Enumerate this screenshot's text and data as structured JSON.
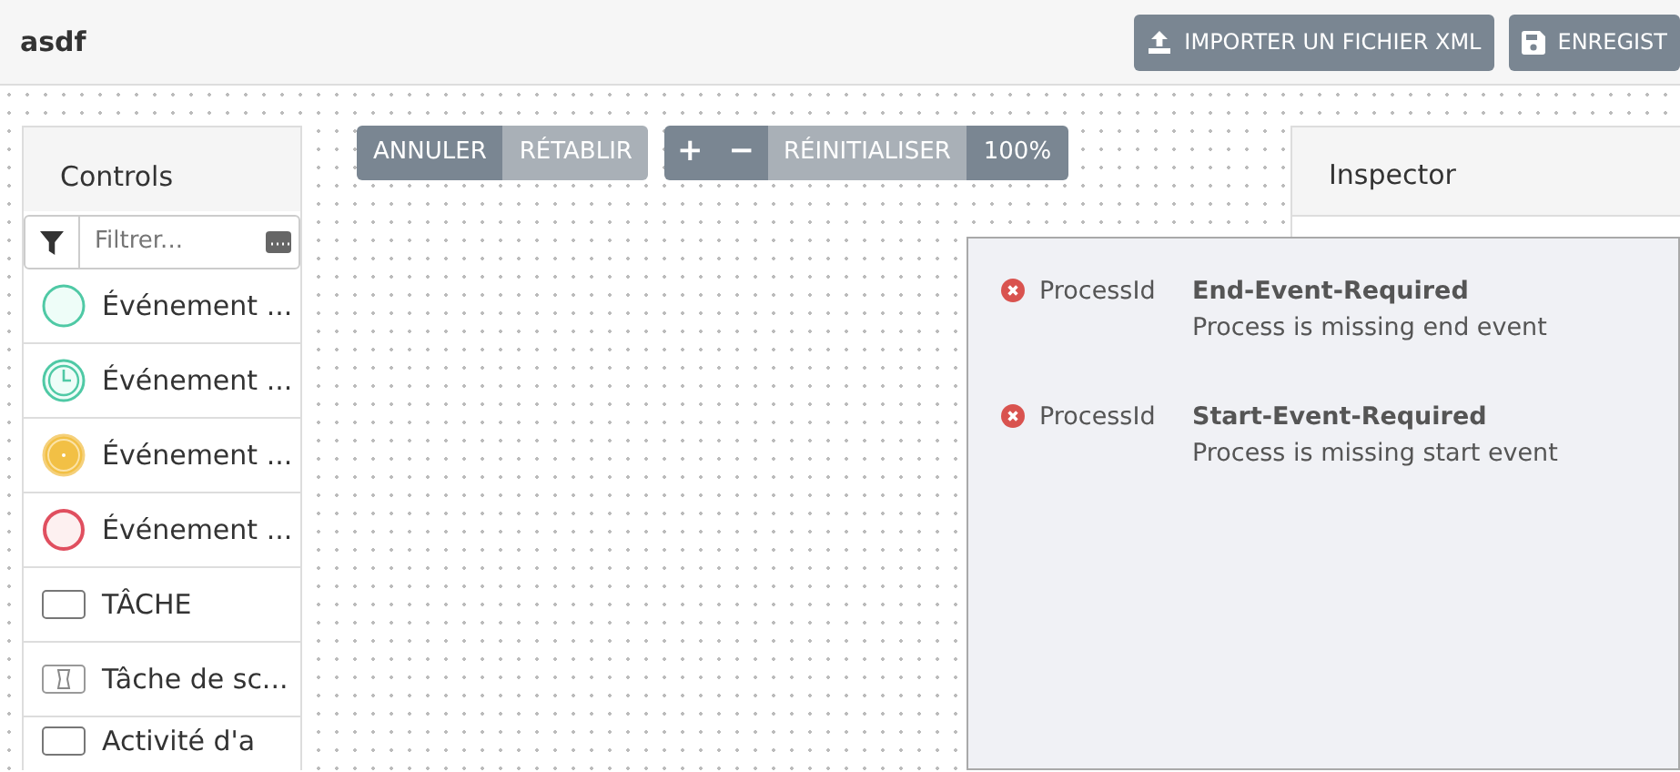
{
  "header": {
    "title": "asdf",
    "buttons": [
      {
        "label": "IMPORTER UN FICHIER XML",
        "kind": "upload"
      },
      {
        "label": "ENREGIST",
        "kind": "save"
      }
    ]
  },
  "toolbar": {
    "groups": [
      [
        {
          "label": "ANNULER",
          "disabled": false
        },
        {
          "label": "RÉTABLIR",
          "disabled": true
        }
      ],
      [
        {
          "label": "+",
          "disabled": false
        },
        {
          "label": "−",
          "disabled": false
        },
        {
          "label": "RÉINITIALISER",
          "disabled": true
        },
        {
          "label": "100%",
          "disabled": false
        }
      ]
    ]
  },
  "controls": {
    "title": "Controls",
    "filter": {
      "placeholder": "Filtrer..."
    },
    "items": [
      {
        "label": "Événement ...",
        "kind": "start-event"
      },
      {
        "label": "Événement ...",
        "kind": "timer-event"
      },
      {
        "label": "Événement ...",
        "kind": "signal-event"
      },
      {
        "label": "Événement ...",
        "kind": "end-event"
      },
      {
        "label": "TÂCHE",
        "kind": "task"
      },
      {
        "label": "Tâche de sc...",
        "kind": "script-task"
      },
      {
        "label": "Activité d'a",
        "kind": "task"
      }
    ]
  },
  "inspector": {
    "title": "Inspector"
  },
  "validation": {
    "issues": [
      {
        "element": "ProcessId",
        "rule": "End-Event-Required",
        "message": "Process is missing end event"
      },
      {
        "element": "ProcessId",
        "rule": "Start-Event-Required",
        "message": "Process is missing start event"
      }
    ]
  }
}
